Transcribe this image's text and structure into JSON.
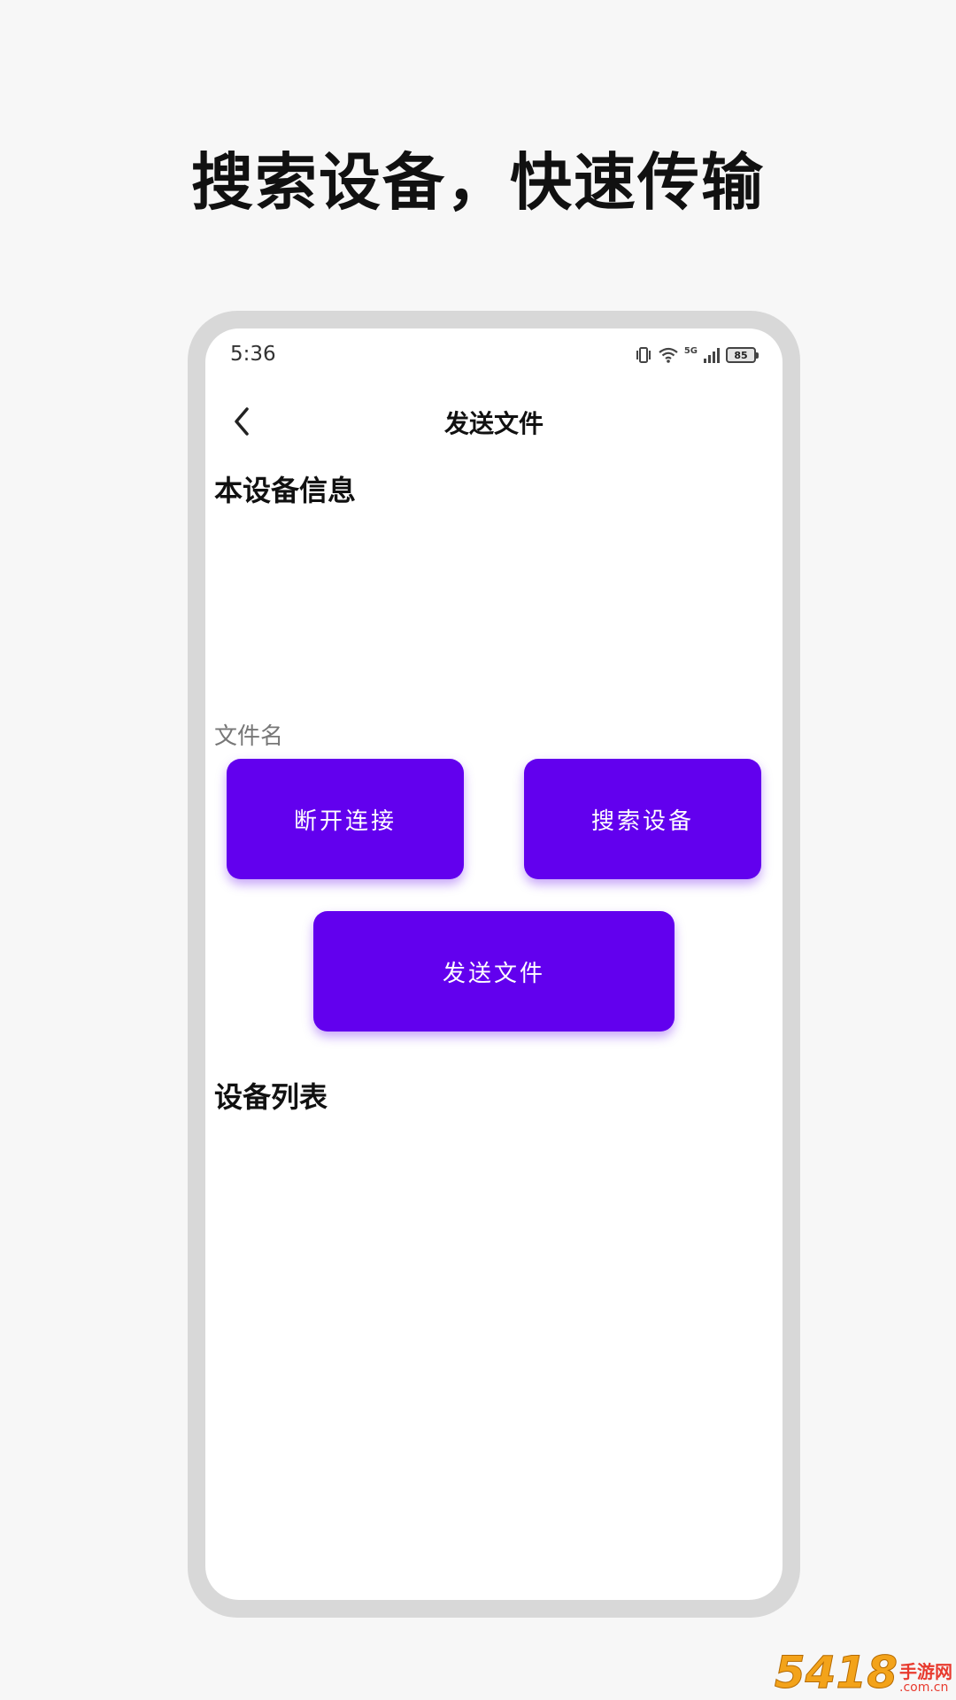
{
  "promo": {
    "title": "搜索设备，快速传输"
  },
  "status_bar": {
    "time": "5:36",
    "battery": "85",
    "network_label": "5G"
  },
  "toolbar": {
    "title": "发送文件",
    "back_icon": "chevron-left-icon"
  },
  "sections": {
    "device_info_title": "本设备信息",
    "file_name_label": "文件名",
    "device_list_title": "设备列表"
  },
  "buttons": {
    "disconnect": "断开连接",
    "search": "搜索设备",
    "send": "发送文件"
  },
  "colors": {
    "accent": "#6200ee",
    "background": "#f7f7f7",
    "frame": "#d8d8d8"
  },
  "watermark": {
    "digits": "5418",
    "cn": "手游网",
    "url": ".com.cn"
  }
}
